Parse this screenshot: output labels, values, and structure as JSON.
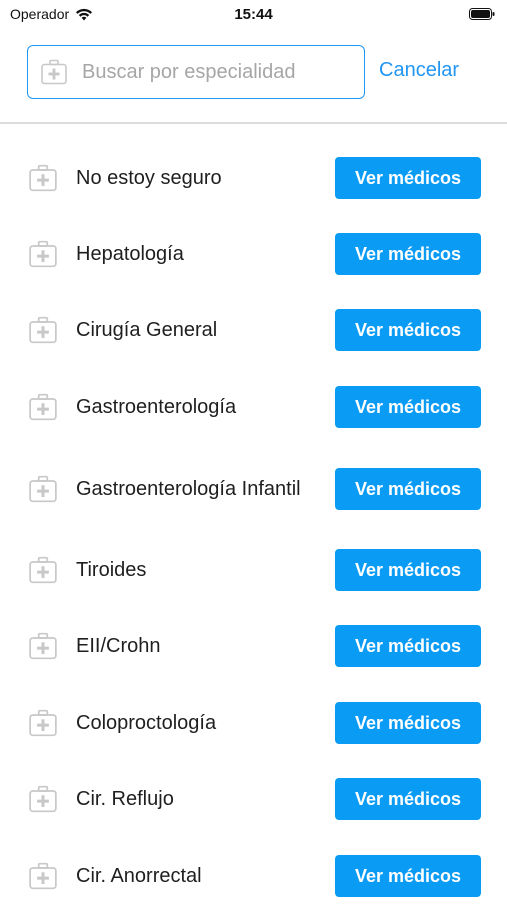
{
  "status_bar": {
    "carrier": "Operador",
    "time": "15:44"
  },
  "search": {
    "placeholder": "Buscar por especialidad",
    "value": "",
    "cancel_label": "Cancelar"
  },
  "colors": {
    "accent": "#0a9bf5",
    "link": "#2196f3",
    "icon": "#c8c8c8"
  },
  "specialties": [
    {
      "label": "No estoy seguro",
      "button": "Ver médicos"
    },
    {
      "label": "Hepatología",
      "button": "Ver médicos"
    },
    {
      "label": "Cirugía General",
      "button": "Ver médicos"
    },
    {
      "label": "Gastroenterología",
      "button": "Ver médicos"
    },
    {
      "label": "Gastroenterología Infantil",
      "button": "Ver médicos"
    },
    {
      "label": "Tiroides",
      "button": "Ver médicos"
    },
    {
      "label": "EII/Crohn",
      "button": "Ver médicos"
    },
    {
      "label": "Coloproctología",
      "button": "Ver médicos"
    },
    {
      "label": "Cir. Reflujo",
      "button": "Ver médicos"
    },
    {
      "label": "Cir. Anorrectal",
      "button": "Ver médicos"
    }
  ],
  "item_icon": "medical-kit-icon"
}
